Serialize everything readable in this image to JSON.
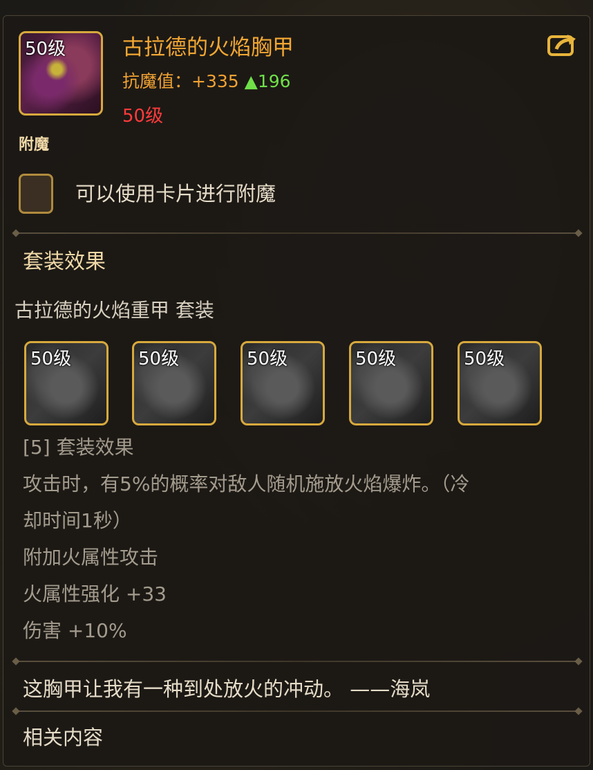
{
  "item": {
    "level_badge": "50级",
    "name": "古拉德的火焰胸甲",
    "stat_label": "抗魔值：",
    "stat_value": "+335",
    "stat_delta": "▲196",
    "required_level": "50级"
  },
  "enchant": {
    "heading": "附魔",
    "slot_text": "可以使用卡片进行附魔"
  },
  "set_effect": {
    "heading": "套装效果",
    "set_name": "古拉德的火焰重甲  套装",
    "pieces": [
      {
        "level": "50级",
        "icon": "helmet-icon"
      },
      {
        "level": "50级",
        "icon": "pants-icon"
      },
      {
        "level": "50级",
        "icon": "shoulder-icon"
      },
      {
        "level": "50级",
        "icon": "belt-icon"
      },
      {
        "level": "50级",
        "icon": "boots-icon"
      }
    ],
    "lines": [
      "[5] 套装效果",
      "攻击时，有5%的概率对敌人随机施放火焰爆炸。（冷",
      "却时间1秒）",
      "附加火属性攻击",
      "火属性强化 +33",
      "伤害 +10%"
    ]
  },
  "flavor_text": "这胸甲让我有一种到处放火的冲动。 ——海岚",
  "related_heading": "相关内容",
  "colors": {
    "item_name": "#f2a733",
    "stat_up": "#6fe048",
    "level_required": "#ff3b3b",
    "frame_gold": "#d7a93d"
  }
}
